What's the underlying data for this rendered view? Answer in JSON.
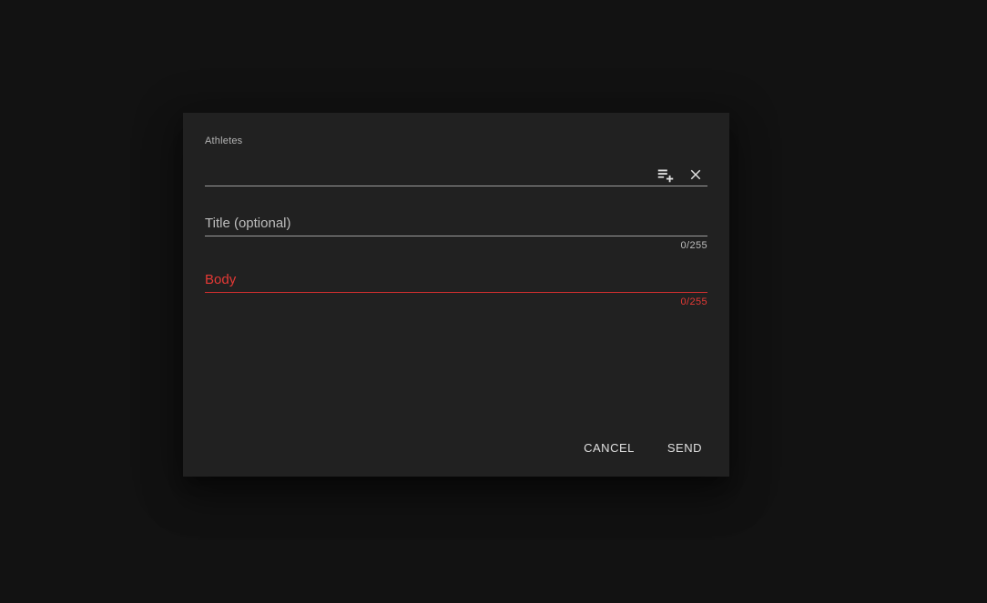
{
  "dialog": {
    "athletes_label": "Athletes",
    "athletes_value": "",
    "title": {
      "placeholder": "Title (optional)",
      "counter": "0/255"
    },
    "body": {
      "placeholder": "Body",
      "counter": "0/255"
    },
    "icons": {
      "list_add": "playlist-add-icon",
      "clear": "close-icon"
    },
    "actions": {
      "cancel": "CANCEL",
      "send": "SEND"
    },
    "colors": {
      "background": "#121212",
      "surface": "#212121",
      "error": "#e53935",
      "line": "#9e9e9e"
    }
  }
}
